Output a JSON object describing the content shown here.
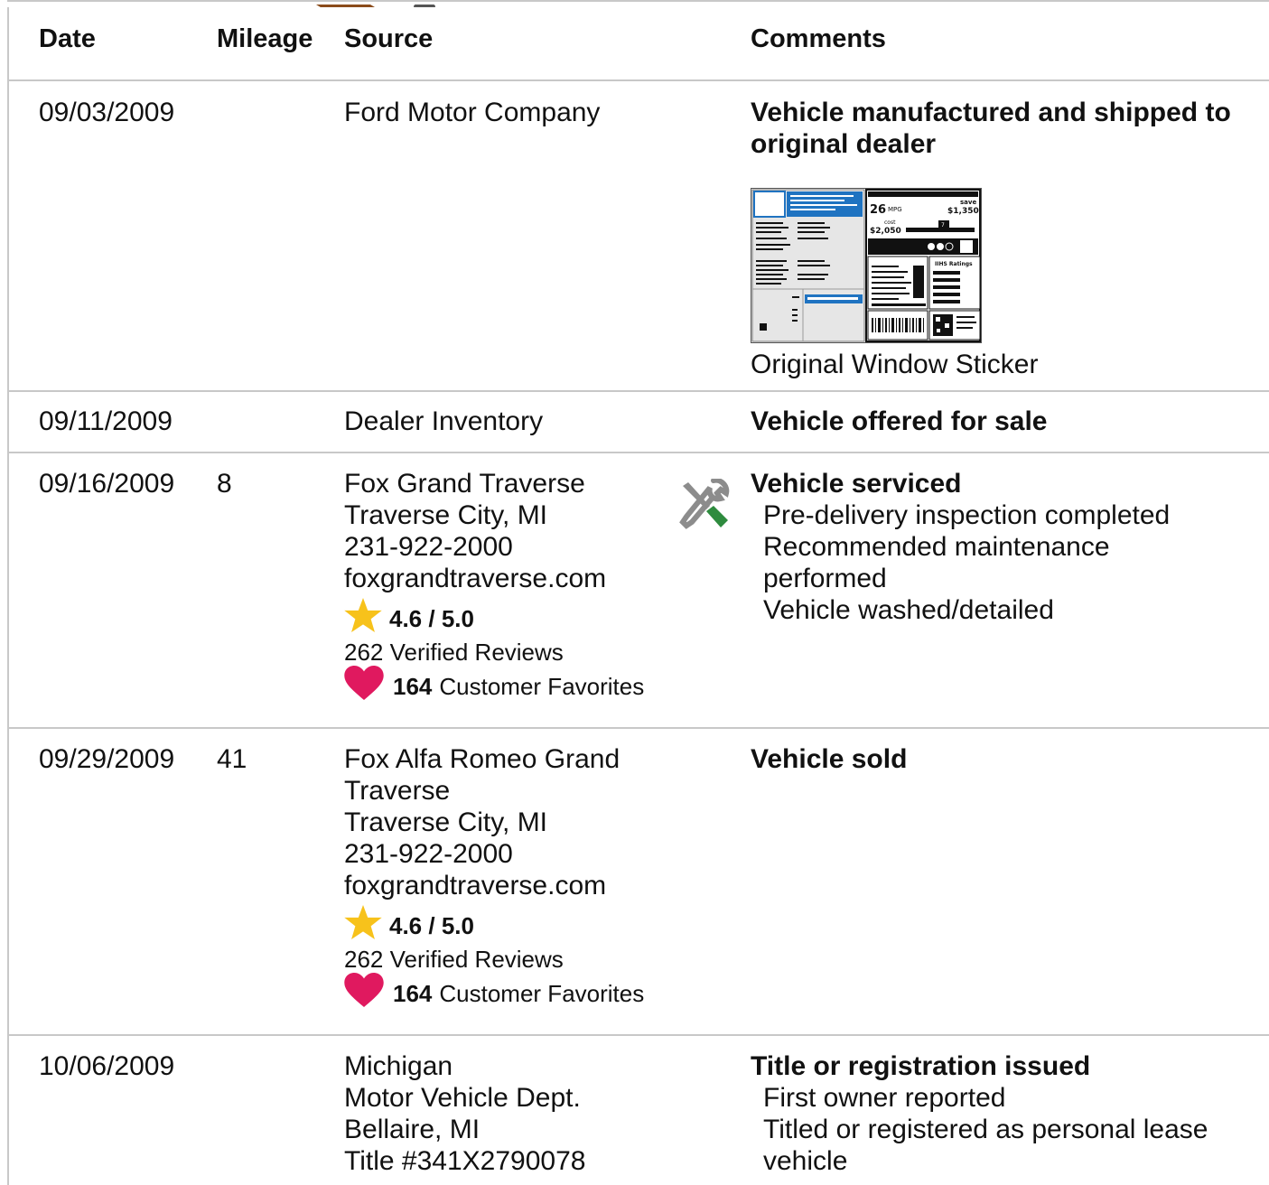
{
  "header": {
    "date": "Date",
    "mileage": "Mileage",
    "source": "Source",
    "comments": "Comments"
  },
  "rows": [
    {
      "date": "09/03/2009",
      "mileage": "",
      "source": [
        "Ford Motor Company"
      ],
      "comment_title": "Vehicle manufactured and shipped to original dealer",
      "sticker": {
        "caption": "Original Window Sticker",
        "mpg": "26",
        "mpg_unit": "MPG",
        "save_label": "save",
        "save_value": "$1,350",
        "cost_label": "cost",
        "cost_value": "$2,050",
        "scale_mark": "7",
        "ratings_title": "IIHS Ratings"
      }
    },
    {
      "date": "09/11/2009",
      "mileage": "",
      "source": [
        "Dealer Inventory"
      ],
      "comment_title": "Vehicle offered for sale"
    },
    {
      "date": "09/16/2009",
      "mileage": "8",
      "source": [
        "Fox Grand Traverse",
        "Traverse City, MI",
        "231-922-2000",
        "foxgrandtraverse.com"
      ],
      "rating": "4.6 / 5.0",
      "reviews": "262 Verified Reviews",
      "favorites_count": "164",
      "favorites_label": "Customer Favorites",
      "comment_title": "Vehicle serviced",
      "comment_items": [
        "Pre-delivery inspection completed",
        "Recommended maintenance performed",
        "Vehicle washed/detailed"
      ]
    },
    {
      "date": "09/29/2009",
      "mileage": "41",
      "source": [
        "Fox Alfa Romeo Grand Traverse",
        "Traverse City, MI",
        "231-922-2000",
        "foxgrandtraverse.com"
      ],
      "rating": "4.6 / 5.0",
      "reviews": "262 Verified Reviews",
      "favorites_count": "164",
      "favorites_label": "Customer Favorites",
      "comment_title": "Vehicle sold"
    },
    {
      "date": "10/06/2009",
      "mileage": "",
      "source": [
        "Michigan",
        "Motor Vehicle Dept.",
        "Bellaire, MI",
        "Title #341X2790078"
      ],
      "comment_title": "Title or registration issued",
      "comment_items": [
        "First owner reported",
        "Titled or registered as personal lease vehicle"
      ]
    }
  ],
  "colors": {
    "border": "#c8c8c8",
    "star": "#f7c21b",
    "heart": "#e0195f",
    "wrench_green": "#2e8b3e",
    "sticker_blue": "#1f73c1"
  }
}
